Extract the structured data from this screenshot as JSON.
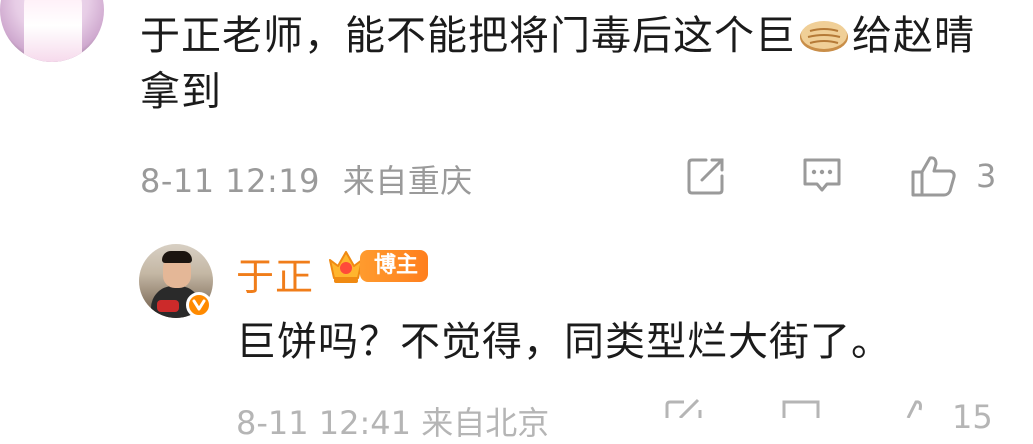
{
  "comment": {
    "text_before_emoji": "于正老师，能不能把将门毒后这个巨",
    "emoji": "bing-emoji",
    "text_after_emoji": "给赵晴拿到",
    "time": "8-11 12:19",
    "location": "来自重庆",
    "share_icon": "share-icon",
    "comment_icon": "comment-icon",
    "like_icon": "thumb-up-icon",
    "like_count": "3"
  },
  "reply": {
    "author": "于正",
    "badge_label": "博主",
    "text": "巨饼吗？不觉得，同类型烂大街了。",
    "meta_partial": "8-11 12:41 来自北京",
    "like_count_partial": "15"
  }
}
